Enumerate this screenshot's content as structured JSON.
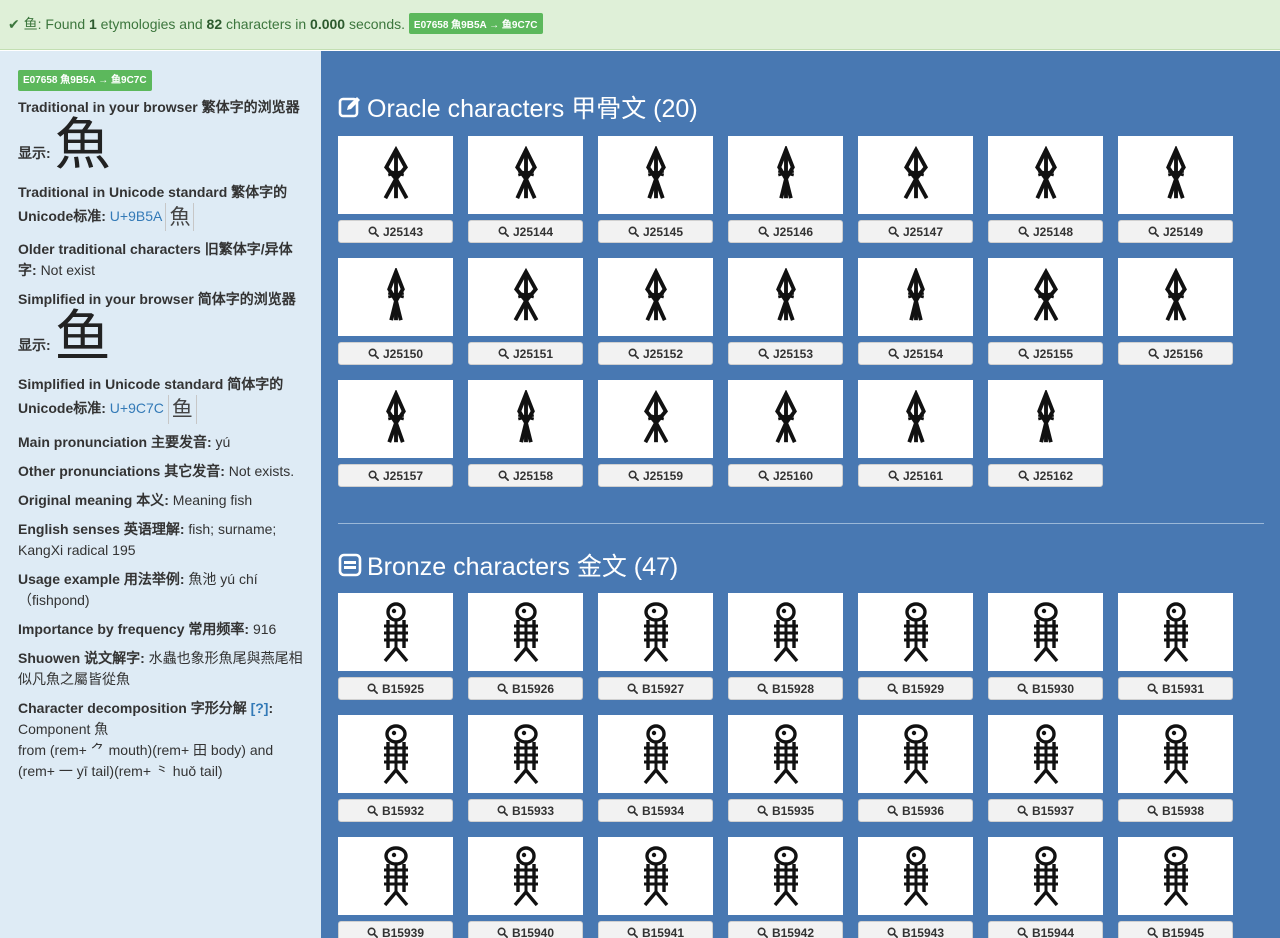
{
  "banner": {
    "check": "✔",
    "char": "鱼",
    "t1": ": Found ",
    "etym_count": "1",
    "t2": " etymologies and ",
    "char_count": "82",
    "t3": " characters in ",
    "seconds": "0.000",
    "t4": " seconds.",
    "tag": "E07658 魚9B5A → 鱼9C7C"
  },
  "sidebar": {
    "tag": "E07658 魚9B5A → 鱼9C7C",
    "trad_browser_label": "Traditional in your browser 繁体字的浏览器显示:",
    "trad_char": "魚",
    "trad_unicode_label": "Traditional in Unicode standard 繁体字的Unicode标准:",
    "trad_unicode": "U+9B5A",
    "trad_glyph": "魚",
    "older_label": "Older traditional characters 旧繁体字/异体字:",
    "older_value": "Not exist",
    "simp_browser_label": "Simplified in your browser 简体字的浏览器显示:",
    "simp_char": "鱼",
    "simp_unicode_label": "Simplified in Unicode standard 简体字的Unicode标准:",
    "simp_unicode": "U+9C7C",
    "simp_glyph": "鱼",
    "main_pron_label": "Main pronunciation 主要发音:",
    "main_pron": "yú",
    "other_pron_label": "Other pronunciations 其它发音:",
    "other_pron": "Not exists.",
    "orig_label": "Original meaning 本义:",
    "orig": "Meaning fish",
    "eng_label": "English senses 英语理解:",
    "eng": "fish; surname; KangXi radical 195",
    "usage_label": "Usage example 用法举例:",
    "usage": "魚池 yú chí （fishpond)",
    "freq_label": "Importance by frequency 常用频率:",
    "freq": "916",
    "shuowen_label": "Shuowen 说文解字:",
    "shuowen": "水蟲也象形魚尾與燕尾相似凡魚之屬皆從魚",
    "decomp_label": "Character decomposition 字形分解",
    "decomp_help": "[?]",
    "decomp_colon": ":",
    "decomp_component": "Component 魚",
    "decomp_from": "from (rem+ ⺈ mouth)(rem+ 田 body) and",
    "decomp_from2": "(rem+ 一 yī tail)(rem+ ⺀ huǒ tail)"
  },
  "oracle": {
    "title": "Oracle characters 甲骨文 (20)",
    "icon": "edit-square-icon",
    "items": [
      "J25143",
      "J25144",
      "J25145",
      "J25146",
      "J25147",
      "J25148",
      "J25149",
      "J25150",
      "J25151",
      "J25152",
      "J25153",
      "J25154",
      "J25155",
      "J25156",
      "J25157",
      "J25158",
      "J25159",
      "J25160",
      "J25161",
      "J25162"
    ]
  },
  "bronze": {
    "title": "Bronze characters 金文 (47)",
    "icon": "bronze-square-icon",
    "items": [
      "B15925",
      "B15926",
      "B15927",
      "B15928",
      "B15929",
      "B15930",
      "B15931",
      "B15932",
      "B15933",
      "B15934",
      "B15935",
      "B15936",
      "B15937",
      "B15938",
      "B15939",
      "B15940",
      "B15941",
      "B15942",
      "B15943",
      "B15944",
      "B15945"
    ]
  },
  "colors": {
    "banner_bg": "#dff0d8",
    "banner_text": "#3c763d",
    "tag_bg": "#5cb85c",
    "sidebar_bg": "#deebf5",
    "main_bg": "#4878b2",
    "link": "#337ab7"
  }
}
